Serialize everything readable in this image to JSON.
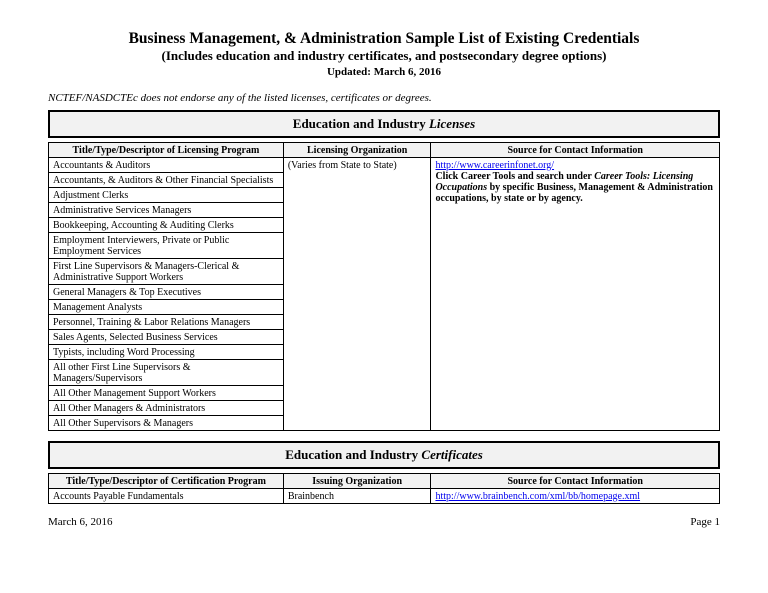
{
  "header": {
    "title": "Business Management, & Administration Sample List of Existing Credentials",
    "subtitle": "(Includes education and industry certificates, and postsecondary degree options)",
    "updated": "Updated:  March 6, 2016"
  },
  "disclaimer": "NCTEF/NASDCTEc does not endorse any of the listed licenses, certificates or degrees.",
  "sections": {
    "licenses": {
      "band_prefix": "Education and Industry ",
      "band_ital": "Licenses",
      "headers": {
        "col1": "Title/Type/Descriptor of Licensing Program",
        "col2": "Licensing Organization",
        "col3": "Source for Contact Information"
      },
      "org": "(Varies from State to State)",
      "source": {
        "link_text": "http://www.careerinfonet.org/",
        "line2a": "Click Career Tools and search under ",
        "line2b": "Career Tools:  Licensing Occupations",
        "line2c": " by specific Business, Management & Administration occupations, by state or by agency."
      },
      "rows": [
        "Accountants & Auditors",
        "Accountants, & Auditors & Other Financial Specialists",
        "Adjustment Clerks",
        "Administrative Services Managers",
        "Bookkeeping, Accounting & Auditing Clerks",
        "Employment Interviewers, Private or Public Employment Services",
        "First Line Supervisors  & Managers-Clerical & Administrative Support Workers",
        "General Managers & Top Executives",
        "Management Analysts",
        "Personnel, Training & Labor Relations Managers",
        "Sales Agents, Selected Business Services",
        "Typists, including Word Processing",
        "All other First Line Supervisors & Managers/Supervisors",
        "All Other Management Support Workers",
        "All Other Managers & Administrators",
        "All Other Supervisors & Managers"
      ]
    },
    "certificates": {
      "band_prefix": "Education and Industry ",
      "band_ital": "Certificates",
      "headers": {
        "col1": "Title/Type/Descriptor of Certification Program",
        "col2": "Issuing Organization",
        "col3": "Source for Contact Information"
      },
      "rows": [
        {
          "title": "Accounts Payable Fundamentals",
          "org": "Brainbench",
          "link": "http://www.brainbench.com/xml/bb/homepage.xml"
        }
      ]
    }
  },
  "footer": {
    "date": "March 6, 2016",
    "page": "Page 1"
  }
}
